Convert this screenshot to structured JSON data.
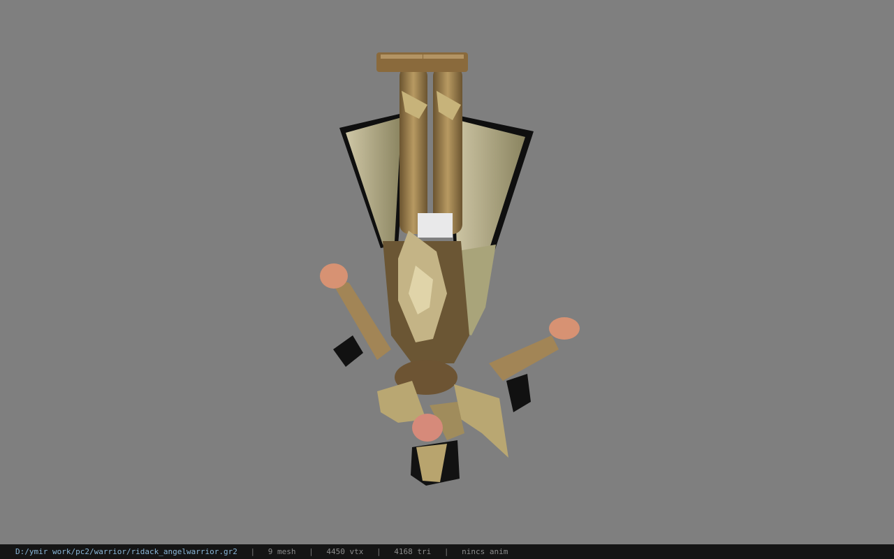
{
  "viewport": {
    "background": "#7f7f7f",
    "model_orientation": "upside-down"
  },
  "statusbar": {
    "file_path": "D:/ymir work/pc2/warrior/ridack_angelwarrior.gr2",
    "separator": "|",
    "mesh": "9 mesh",
    "vertices": "4450 vtx",
    "triangles": "4168 tri",
    "anim": "nincs anim"
  },
  "colors": {
    "armor_gold": "#a89562",
    "armor_dark": "#5a4a2c",
    "skin": "#d79273",
    "cloth_black": "#111111"
  }
}
